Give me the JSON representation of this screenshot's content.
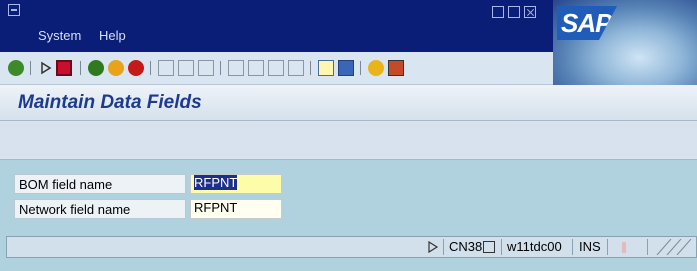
{
  "menu": {
    "items": [
      "System",
      "Help"
    ]
  },
  "header": {
    "title": "Maintain Data Fields"
  },
  "form": {
    "bom_label": "BOM field name",
    "bom_value": "RFPNT",
    "network_label": "Network field name",
    "network_value": "RFPNT"
  },
  "status": {
    "transaction": "CN38",
    "server": "w11tdc00",
    "mode": "INS"
  },
  "brand": {
    "logo": "SAP"
  },
  "colors": {
    "title_bar": "#0a1e78",
    "title_text": "#1e3a8e",
    "content_bg": "#b0d2de"
  }
}
